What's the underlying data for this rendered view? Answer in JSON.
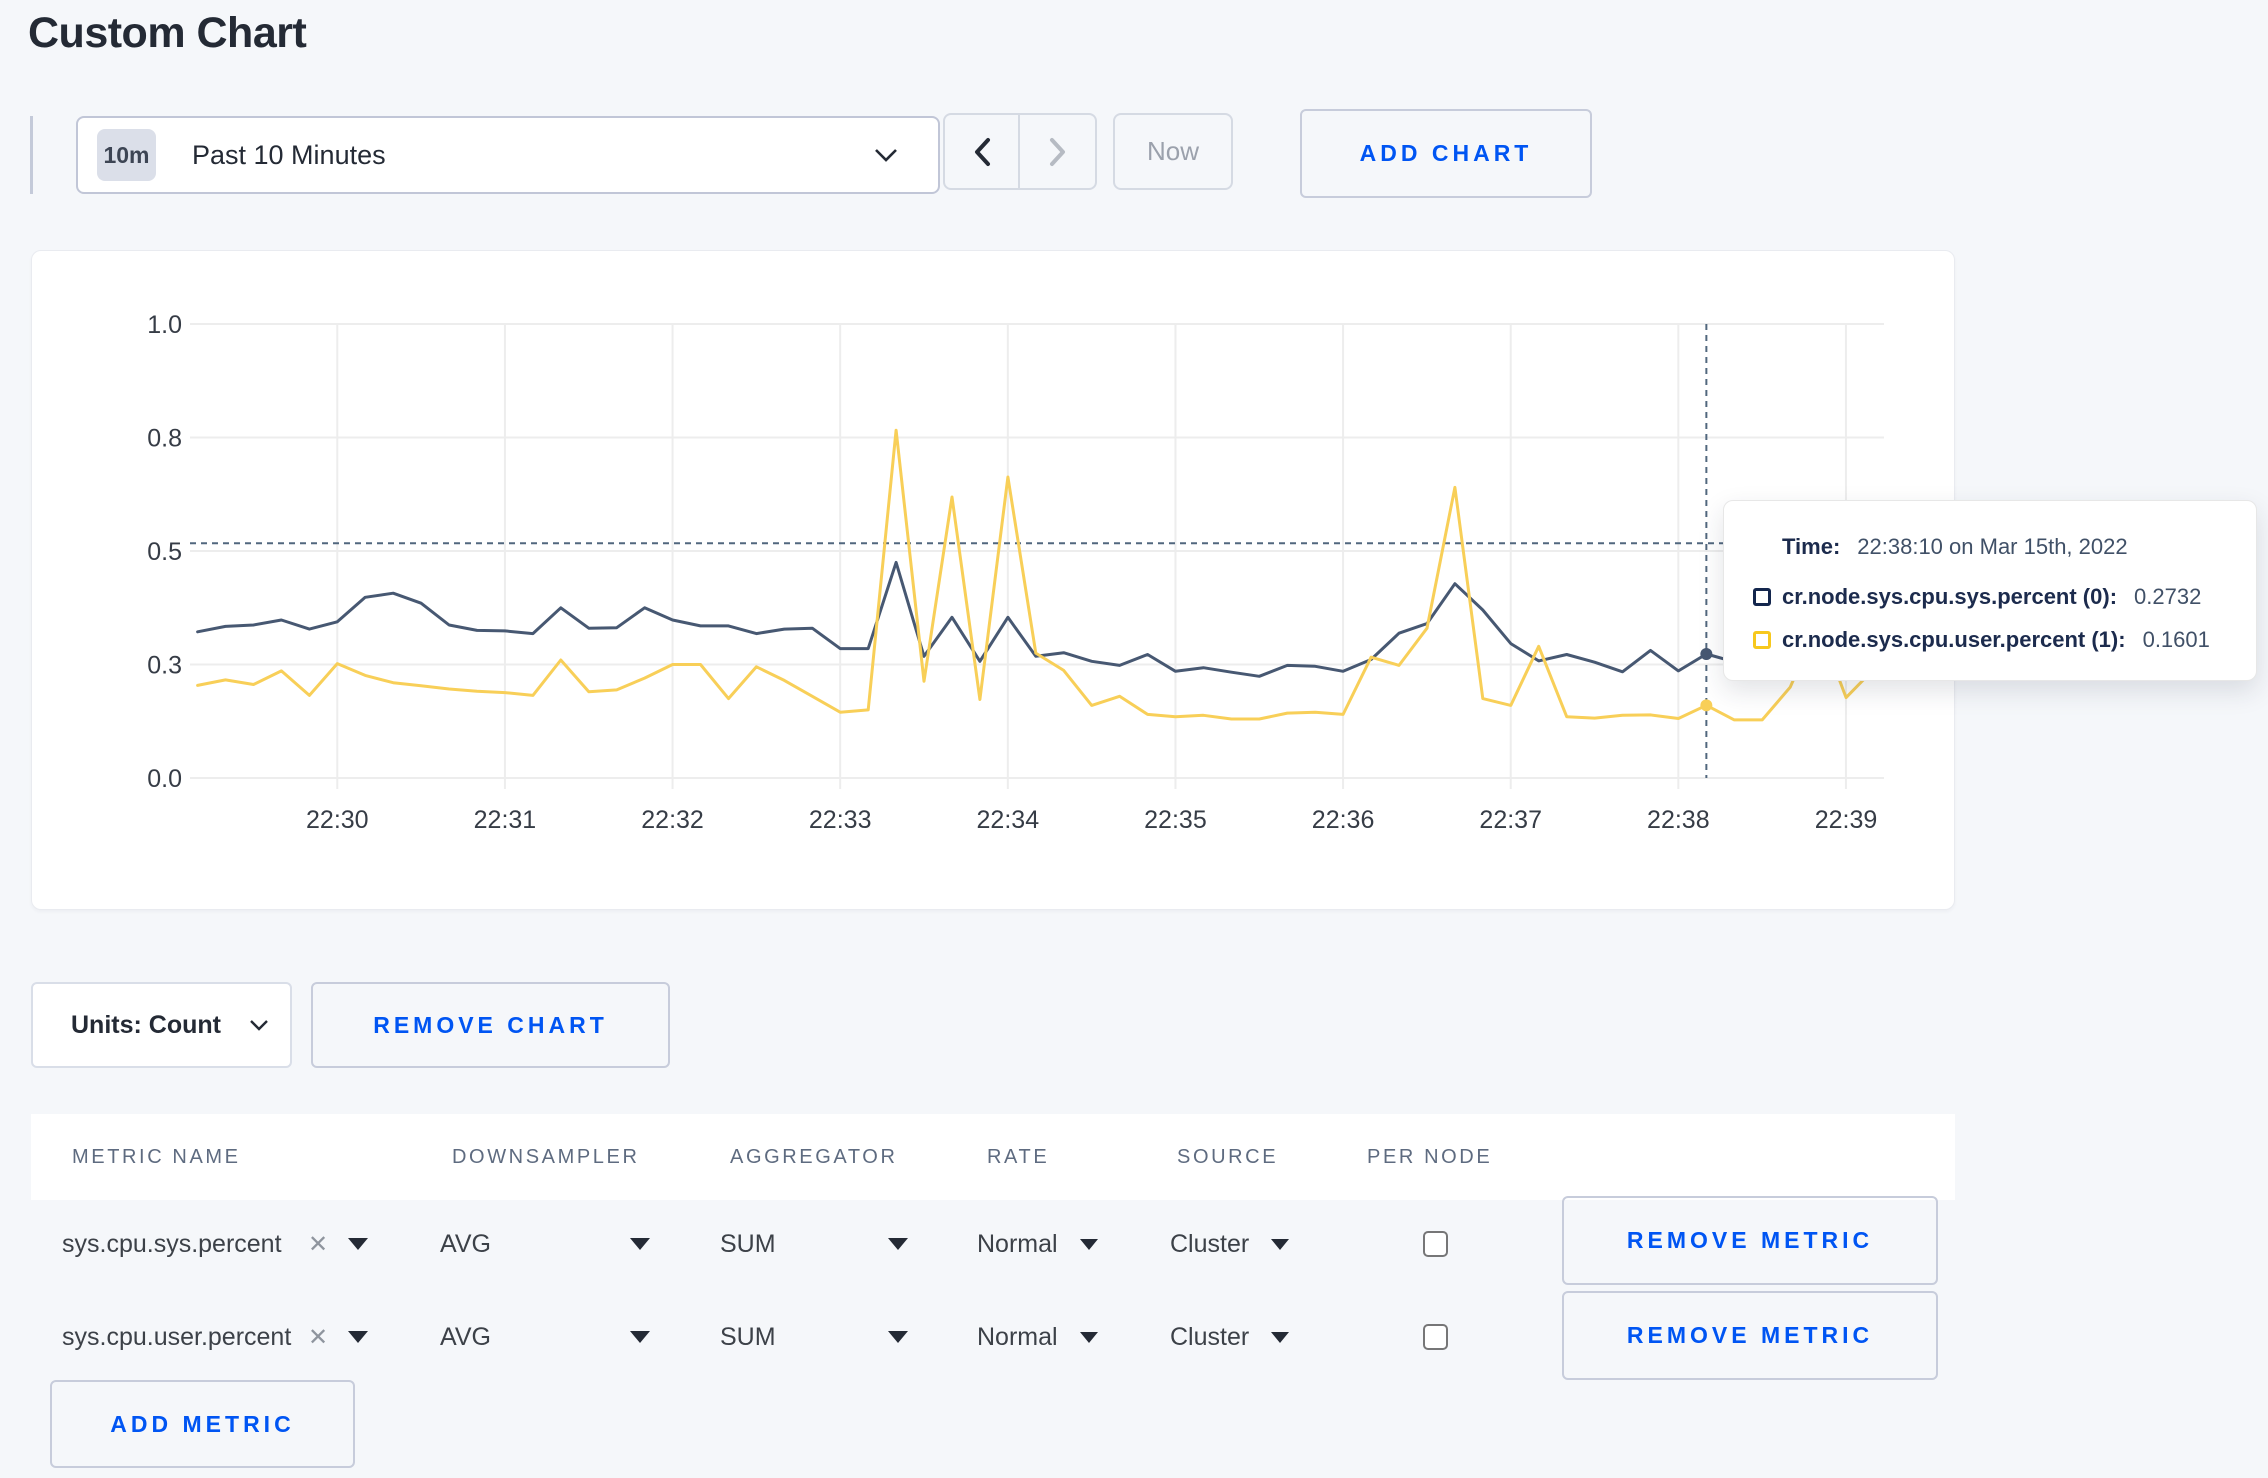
{
  "page": {
    "title": "Custom Chart"
  },
  "toolbar": {
    "time_range": {
      "badge": "10m",
      "label": "Past 10 Minutes"
    },
    "now_label": "Now",
    "add_chart_label": "ADD CHART"
  },
  "chart_data": {
    "type": "line",
    "x_ticks": [
      "22:30",
      "22:31",
      "22:32",
      "22:33",
      "22:34",
      "22:35",
      "22:36",
      "22:37",
      "22:38",
      "22:39"
    ],
    "y_ticks": [
      "0.0",
      "0.3",
      "0.5",
      "0.8",
      "1.0"
    ],
    "ylim": [
      0,
      1
    ],
    "start_time": "22:29:10",
    "end_time": "22:39:10",
    "interval_seconds": 10,
    "series": [
      {
        "name": "cr.node.sys.cpu.sys.percent",
        "color": "#475872",
        "values": [
          0.322,
          0.334,
          0.337,
          0.348,
          0.328,
          0.344,
          0.398,
          0.407,
          0.385,
          0.337,
          0.325,
          0.324,
          0.318,
          0.375,
          0.33,
          0.331,
          0.375,
          0.348,
          0.335,
          0.335,
          0.318,
          0.328,
          0.33,
          0.285,
          0.285,
          0.475,
          0.268,
          0.354,
          0.257,
          0.354,
          0.268,
          0.276,
          0.257,
          0.248,
          0.272,
          0.235,
          0.243,
          0.233,
          0.224,
          0.248,
          0.246,
          0.235,
          0.261,
          0.319,
          0.34,
          0.428,
          0.37,
          0.296,
          0.258,
          0.272,
          0.255,
          0.234,
          0.281,
          0.236,
          0.2732,
          0.256,
          0.27,
          0.26,
          0.28,
          0.3,
          0.3
        ]
      },
      {
        "name": "cr.node.sys.cpu.user.percent",
        "color": "#f8cf58",
        "values": [
          0.204,
          0.216,
          0.206,
          0.236,
          0.182,
          0.252,
          0.226,
          0.21,
          0.203,
          0.196,
          0.191,
          0.188,
          0.182,
          0.26,
          0.19,
          0.194,
          0.22,
          0.25,
          0.25,
          0.175,
          0.245,
          0.215,
          0.18,
          0.145,
          0.15,
          0.766,
          0.213,
          0.619,
          0.173,
          0.663,
          0.275,
          0.237,
          0.16,
          0.18,
          0.14,
          0.135,
          0.138,
          0.13,
          0.13,
          0.143,
          0.145,
          0.14,
          0.266,
          0.248,
          0.33,
          0.64,
          0.175,
          0.16,
          0.29,
          0.135,
          0.132,
          0.138,
          0.139,
          0.131,
          0.1601,
          0.128,
          0.128,
          0.2,
          0.34,
          0.177,
          0.24
        ]
      }
    ],
    "crosshair": {
      "time_index": 54,
      "mouse_y_value": 0.517
    }
  },
  "tooltip": {
    "time_label": "Time:",
    "time_value": "22:38:10 on Mar 15th, 2022",
    "rows": [
      {
        "label": "cr.node.sys.cpu.sys.percent (0):",
        "value": "0.2732",
        "swatch": "#13264d"
      },
      {
        "label": "cr.node.sys.cpu.user.percent (1):",
        "value": "0.1601",
        "swatch": "#f7c81d"
      }
    ]
  },
  "chart_controls": {
    "units_label": "Units: Count",
    "remove_chart_label": "REMOVE CHART"
  },
  "metrics_table": {
    "headers": [
      "METRIC NAME",
      "DOWNSAMPLER",
      "AGGREGATOR",
      "RATE",
      "SOURCE",
      "PER NODE"
    ],
    "rows": [
      {
        "metric_name": "sys.cpu.sys.percent",
        "downsampler": "AVG",
        "aggregator": "SUM",
        "rate": "Normal",
        "source": "Cluster",
        "per_node_checked": false,
        "remove_label": "REMOVE METRIC"
      },
      {
        "metric_name": "sys.cpu.user.percent",
        "downsampler": "AVG",
        "aggregator": "SUM",
        "rate": "Normal",
        "source": "Cluster",
        "per_node_checked": false,
        "remove_label": "REMOVE METRIC"
      }
    ],
    "add_metric_label": "ADD METRIC"
  }
}
